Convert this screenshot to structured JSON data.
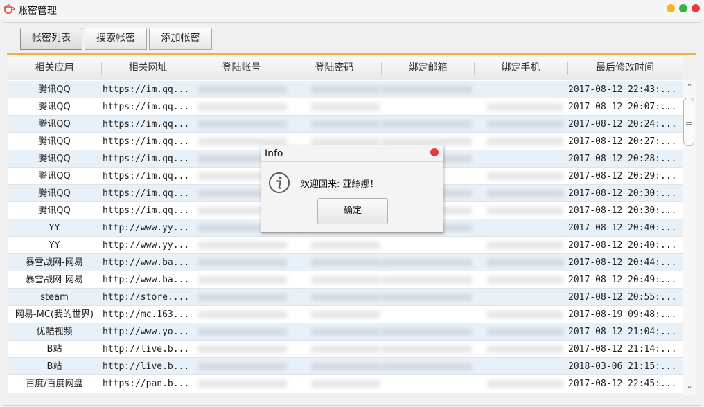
{
  "window": {
    "title": "账密管理"
  },
  "tabs": [
    {
      "label": "帐密列表"
    },
    {
      "label": "搜索帐密"
    },
    {
      "label": "添加帐密"
    }
  ],
  "columns": [
    "相关应用",
    "相关网址",
    "登陆账号",
    "登陆密码",
    "绑定邮箱",
    "绑定手机",
    "最后修改时间"
  ],
  "rows": [
    {
      "app": "腾讯QQ",
      "url": "https://im.qq...",
      "time": "2017-08-12 22:43:..."
    },
    {
      "app": "腾讯QQ",
      "url": "https://im.qq...",
      "time": "2017-08-12 20:07:..."
    },
    {
      "app": "腾讯QQ",
      "url": "https://im.qq...",
      "time": "2017-08-12 20:24:..."
    },
    {
      "app": "腾讯QQ",
      "url": "https://im.qq...",
      "time": "2017-08-12 20:27:..."
    },
    {
      "app": "腾讯QQ",
      "url": "https://im.qq...",
      "time": "2017-08-12 20:28:..."
    },
    {
      "app": "腾讯QQ",
      "url": "https://im.qq...",
      "time": "2017-08-12 20:29:..."
    },
    {
      "app": "腾讯QQ",
      "url": "https://im.qq...",
      "time": "2017-08-12 20:30:..."
    },
    {
      "app": "腾讯QQ",
      "url": "https://im.qq...",
      "time": "2017-08-12 20:30:..."
    },
    {
      "app": "YY",
      "url": "http://www.yy...",
      "time": "2017-08-12 20:40:..."
    },
    {
      "app": "YY",
      "url": "http://www.yy...",
      "time": "2017-08-12 20:40:..."
    },
    {
      "app": "暴雪战网-网易",
      "url": "http://www.ba...",
      "time": "2017-08-12 20:44:..."
    },
    {
      "app": "暴雪战网-网易",
      "url": "http://www.ba...",
      "time": "2017-08-12 20:49:..."
    },
    {
      "app": "steam",
      "url": "http://store....",
      "time": "2017-08-12 20:55:..."
    },
    {
      "app": "网易-MC(我的世界)",
      "url": "http://mc.163...",
      "time": "2017-08-19 09:48:..."
    },
    {
      "app": "优酷视频",
      "url": "http://www.yo...",
      "time": "2017-08-12 21:04:..."
    },
    {
      "app": "B站",
      "url": "http://live.b...",
      "time": "2017-08-12 21:14:..."
    },
    {
      "app": "B站",
      "url": "http://live.b...",
      "time": "2018-03-06 21:15:..."
    },
    {
      "app": "百度/百度网盘",
      "url": "https://pan.b...",
      "time": "2017-08-12 22:45:..."
    }
  ],
  "dialog": {
    "title": "Info",
    "message": "欢迎回来: 亚絲娜！",
    "ok_label": "确定"
  },
  "colors": {
    "accent": "#f0ad4e",
    "row_alt": "#e8f1f8",
    "close": "#e83a3a",
    "minimize": "#f3b71b",
    "maximize": "#34b34a"
  }
}
